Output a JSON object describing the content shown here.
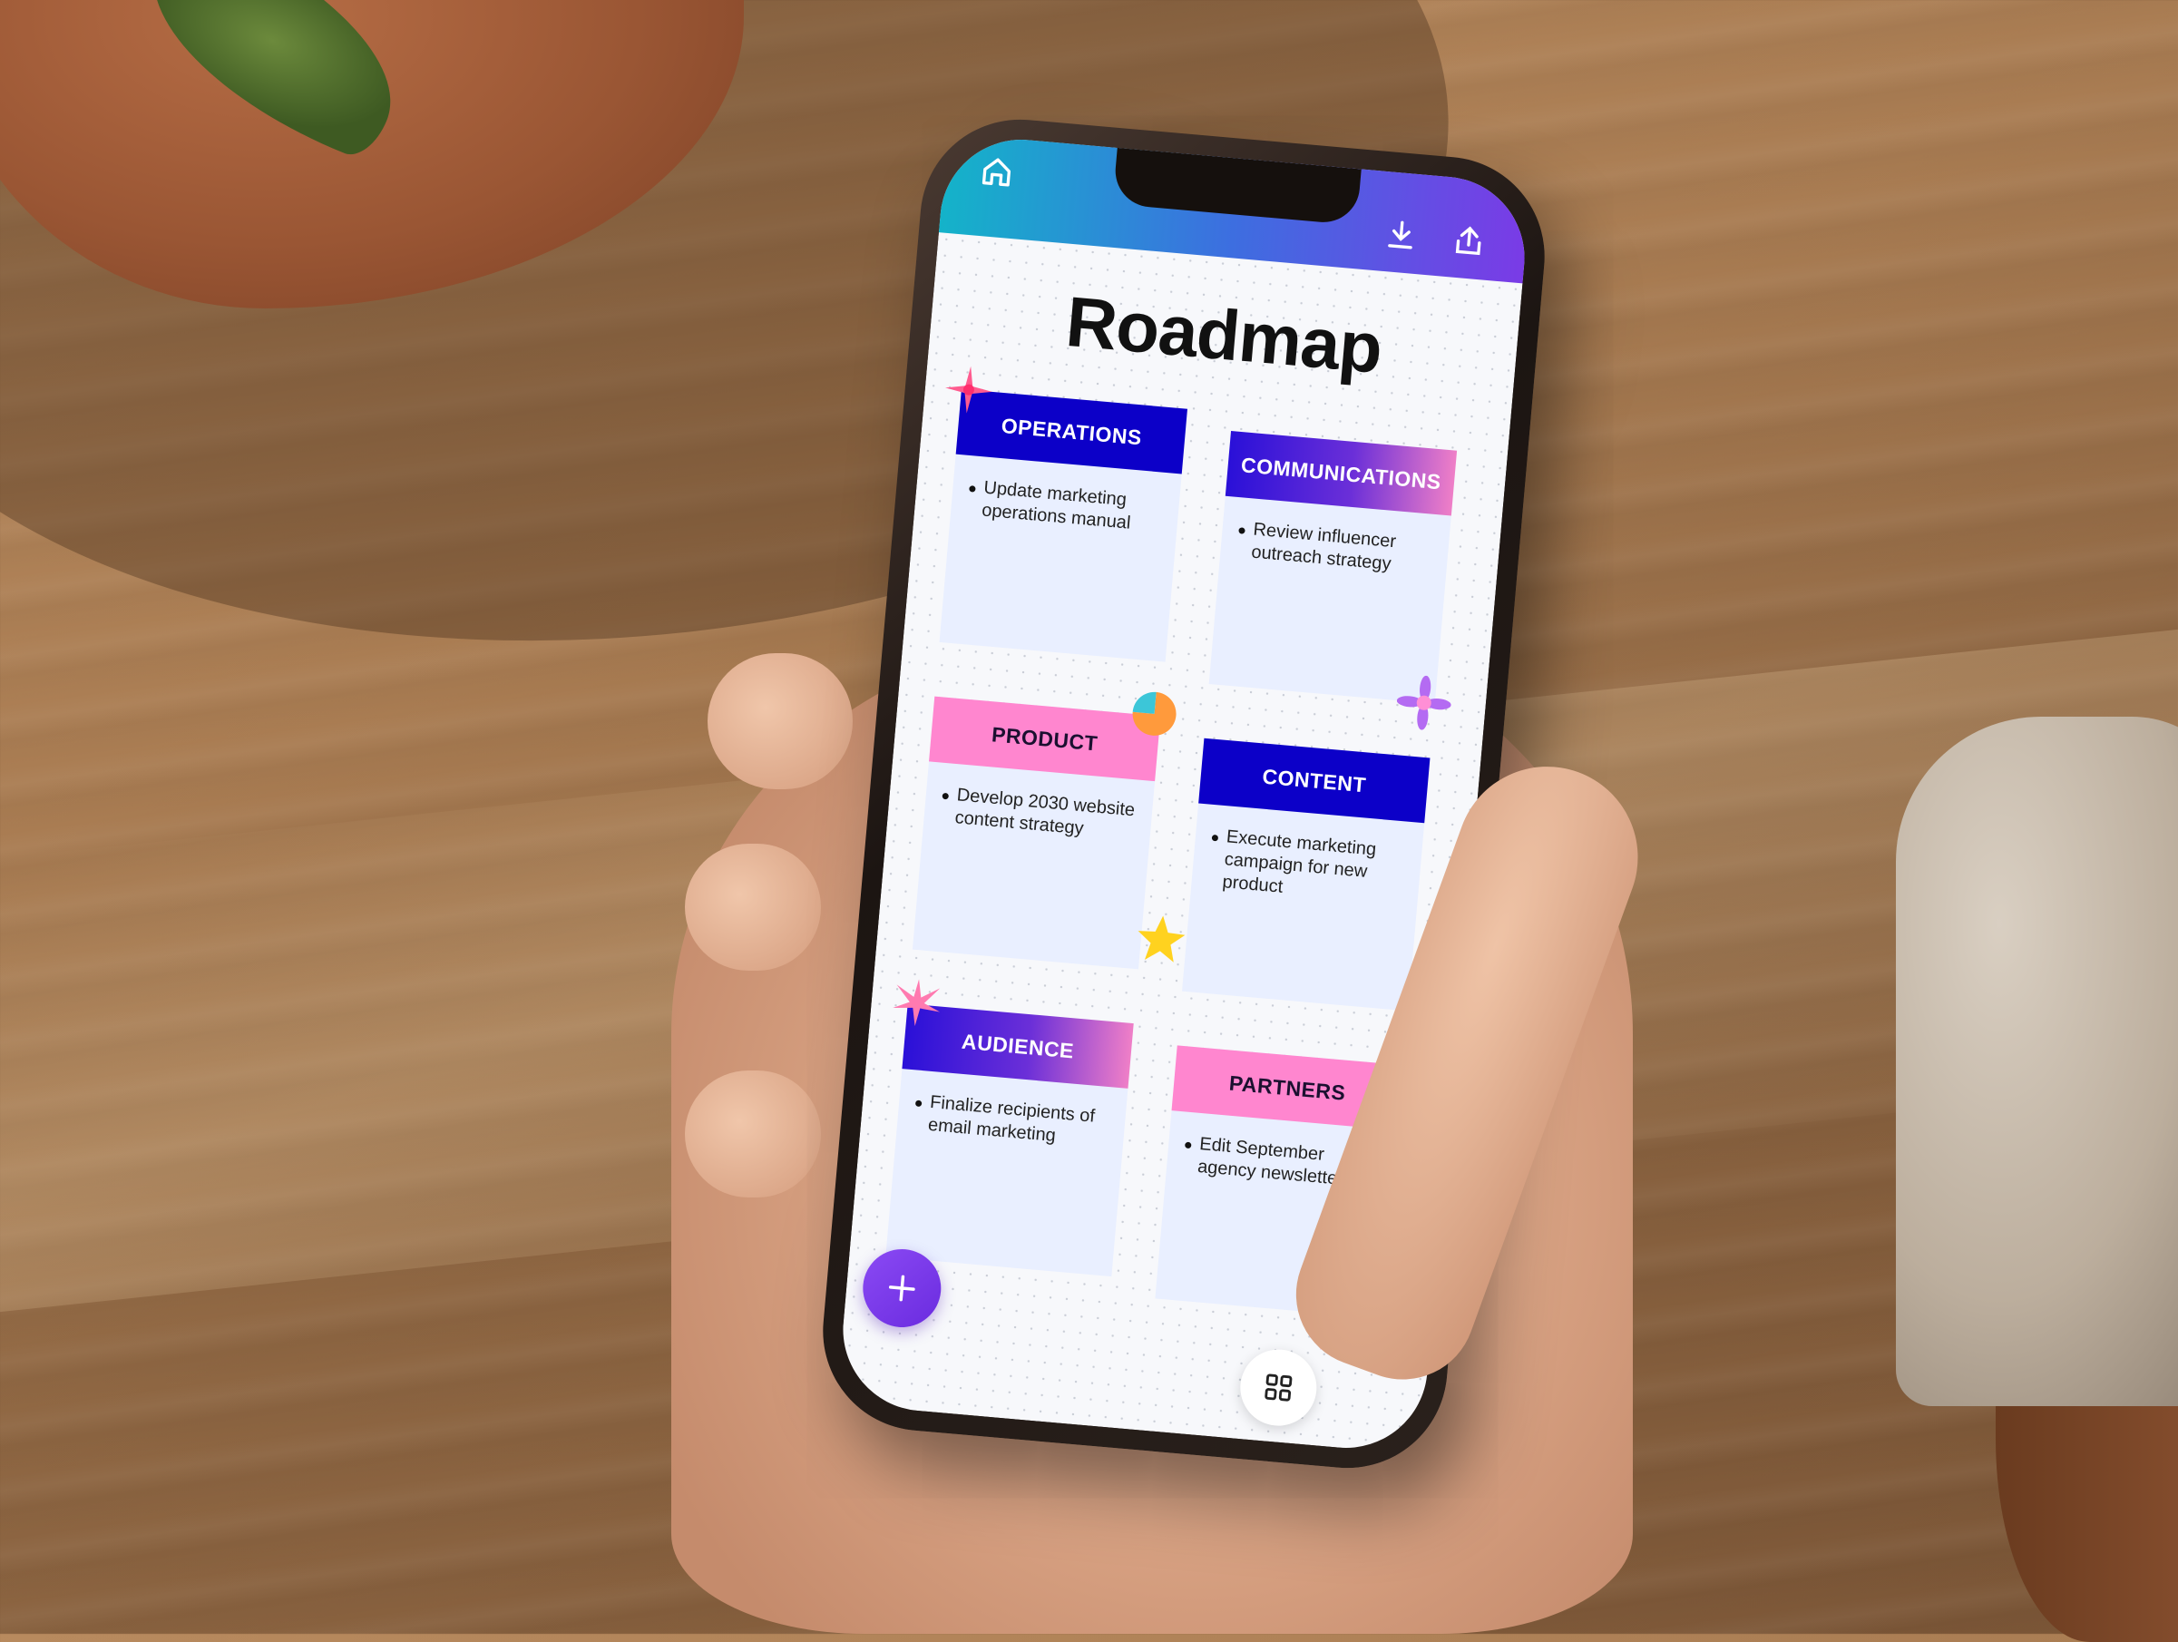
{
  "app": {
    "title": "Roadmap"
  },
  "toolbar": {
    "home_icon": "home-icon",
    "download_icon": "download-icon",
    "share_icon": "share-icon"
  },
  "cards": [
    {
      "header": "OPERATIONS",
      "item": "Update marketing operations manual"
    },
    {
      "header": "COMMUNICATIONS",
      "item": "Review influencer outreach strategy"
    },
    {
      "header": "PRODUCT",
      "item": "Develop 2030 website content strategy"
    },
    {
      "header": "CONTENT",
      "item": "Execute marketing campaign for new product"
    },
    {
      "header": "AUDIENCE",
      "item": "Finalize recipients of email marketing"
    },
    {
      "header": "PARTNERS",
      "item": "Edit September agency newsletter"
    }
  ],
  "actions": {
    "add_icon": "plus-icon",
    "grid_icon": "grid-icon"
  },
  "colors": {
    "header_blue": "#0c00c8",
    "header_pink": "#ff86cf",
    "card_body": "#e9efff",
    "fab_purple": "#7b3bef",
    "topbar_start": "#14b3c9",
    "topbar_end": "#7a3be6"
  }
}
